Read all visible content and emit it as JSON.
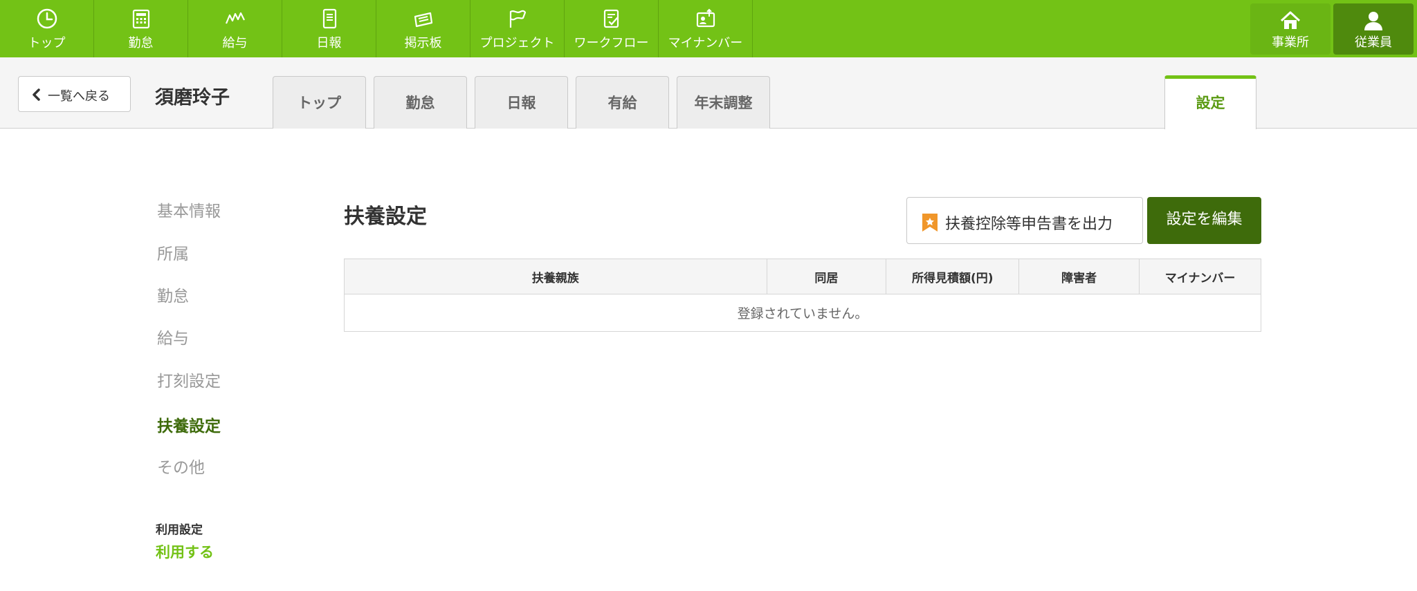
{
  "top_nav": {
    "items": [
      {
        "label": "トップ",
        "icon": "clock-icon"
      },
      {
        "label": "勤怠",
        "icon": "calculator-icon"
      },
      {
        "label": "給与",
        "icon": "chart-icon"
      },
      {
        "label": "日報",
        "icon": "notebook-icon"
      },
      {
        "label": "掲示板",
        "icon": "board-icon"
      },
      {
        "label": "プロジェクト",
        "icon": "flag-icon"
      },
      {
        "label": "ワークフロー",
        "icon": "checklist-icon"
      },
      {
        "label": "マイナンバー",
        "icon": "id-card-icon"
      }
    ],
    "office": {
      "label": "事業所",
      "icon": "home-icon"
    },
    "employee": {
      "label": "従業員",
      "icon": "person-icon"
    }
  },
  "subheader": {
    "back_label": "一覧へ戻る",
    "employee_name": "須磨玲子",
    "tabs": [
      {
        "label": "トップ"
      },
      {
        "label": "勤怠"
      },
      {
        "label": "日報"
      },
      {
        "label": "有給"
      },
      {
        "label": "年末調整"
      }
    ],
    "settings_tab": "設定"
  },
  "sidebar": {
    "items": [
      {
        "label": "基本情報"
      },
      {
        "label": "所属"
      },
      {
        "label": "勤怠"
      },
      {
        "label": "給与"
      },
      {
        "label": "打刻設定"
      },
      {
        "label": "扶養設定"
      },
      {
        "label": "その他"
      }
    ],
    "active_item": "扶養設定",
    "usage_label": "利用設定",
    "usage_value": "利用する"
  },
  "main": {
    "title": "扶養設定",
    "export_button": "扶養控除等申告書を出力",
    "edit_button": "設定を編集",
    "table": {
      "headers": [
        "扶養親族",
        "同居",
        "所得見積額(円)",
        "障害者",
        "マイナンバー"
      ],
      "empty_message": "登録されていません。"
    }
  },
  "colors": {
    "brand_green": "#73c216",
    "dark_green": "#3e6b0b",
    "badge_orange": "#f0962a"
  }
}
